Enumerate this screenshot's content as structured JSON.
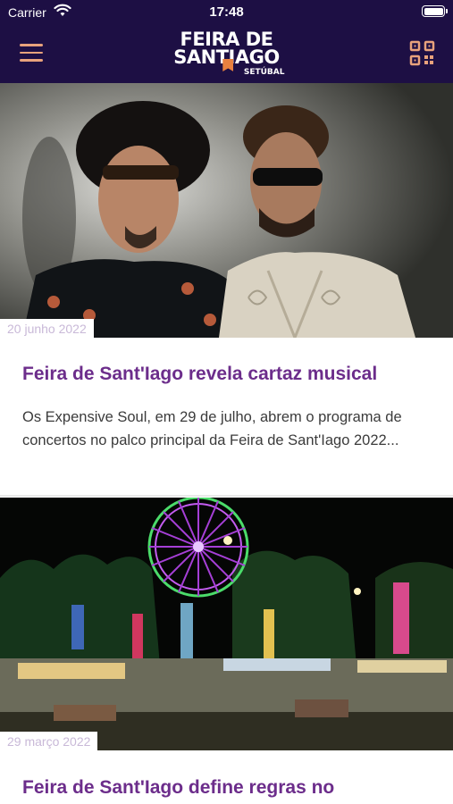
{
  "status_bar": {
    "carrier": "Carrier",
    "time": "17:48"
  },
  "header": {
    "logo_line1": "FEIRA DE",
    "logo_line2": "SANTIAGO",
    "logo_line3": "SETÚBAL",
    "menu_icon": "hamburger-menu-icon",
    "qr_icon": "qr-code-icon"
  },
  "colors": {
    "header_bg": "#1d0f44",
    "accent": "#e8a27c",
    "title": "#6c2d8b"
  },
  "articles": [
    {
      "date": "20 junho 2022",
      "title": "Feira de Sant'Iago revela cartaz musical",
      "excerpt": "Os Expensive Soul, em 29 de julho, abrem o programa de concertos no palco principal da Feira de Sant'Iago 2022..."
    },
    {
      "date": "29 março 2022",
      "title": "Feira de Sant'Iago define regras no"
    }
  ]
}
